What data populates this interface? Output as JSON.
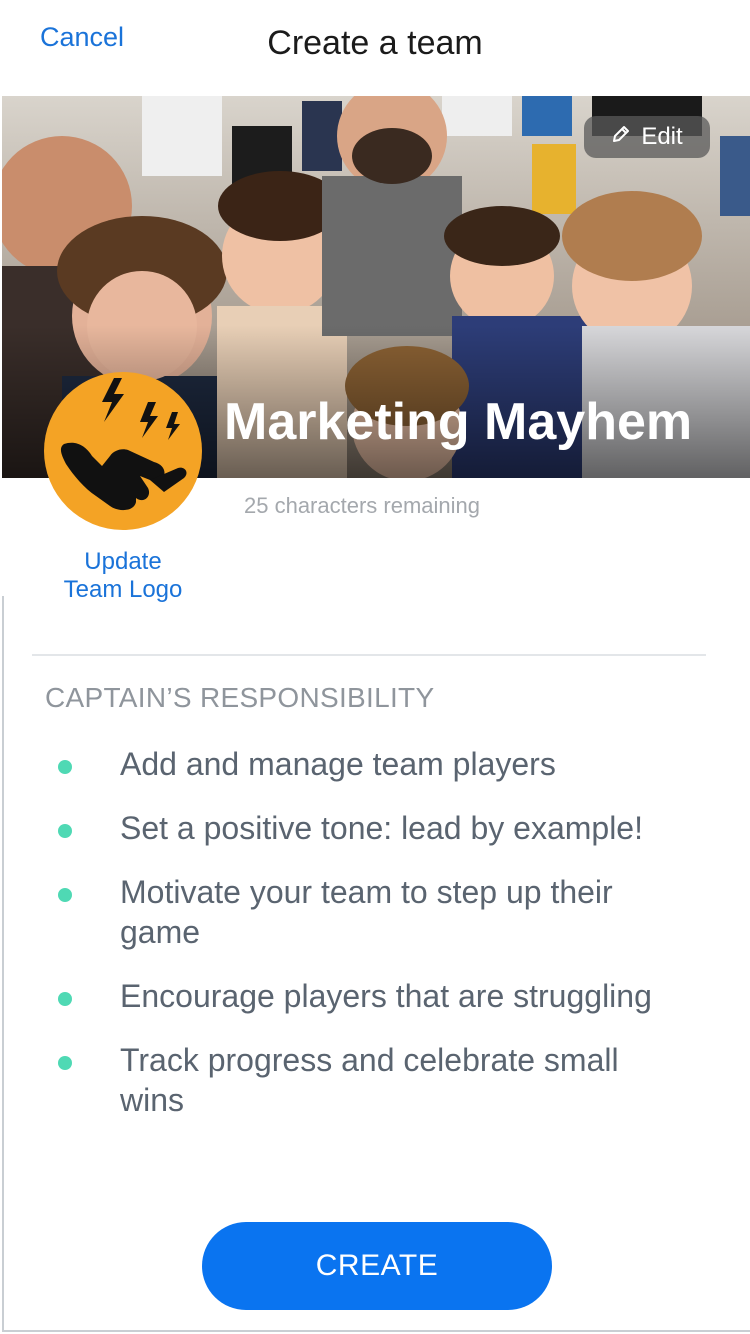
{
  "header": {
    "cancel_label": "Cancel",
    "title": "Create a team"
  },
  "hero": {
    "edit_label": "Edit",
    "team_name": "Marketing Mayhem"
  },
  "logo": {
    "update_line1": "Update",
    "update_line2": "Team Logo",
    "icon": "shaka-hand-icon",
    "background_color": "#f4a325"
  },
  "name_field": {
    "remaining_text": "25 characters remaining"
  },
  "responsibility": {
    "heading": "CAPTAIN’S RESPONSIBILITY",
    "items": [
      "Add and manage team players",
      "Set a positive tone: lead by example!",
      "Motivate your team to step up their game",
      "Encourage players that are struggling",
      "Track progress and celebrate small wins"
    ]
  },
  "actions": {
    "create_label": "CREATE"
  },
  "colors": {
    "accent": "#0a74f0",
    "link": "#1a73d9",
    "bullet": "#4fd9b4"
  }
}
